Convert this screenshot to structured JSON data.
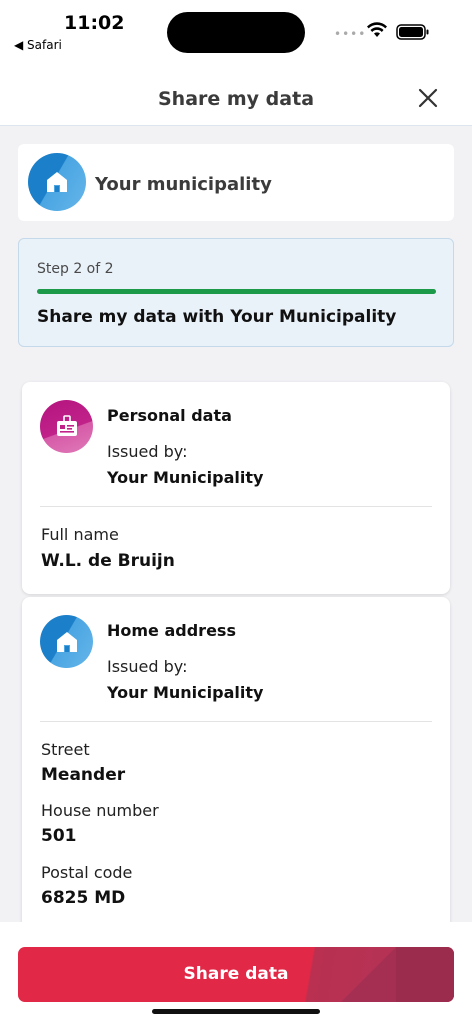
{
  "status_bar": {
    "time": "11:02",
    "back_app": "◀ Safari"
  },
  "header": {
    "title": "Share my data"
  },
  "organization": {
    "name": "Your municipality"
  },
  "step": {
    "label": "Step 2 of 2",
    "progress": 1.0,
    "title": "Share my data with Your Municipality"
  },
  "cards": [
    {
      "title": "Personal data",
      "issued_label": "Issued by:",
      "issuer": "Your Municipality",
      "fields": [
        {
          "label": "Full name",
          "value": "W.L. de Bruijn"
        }
      ]
    },
    {
      "title": "Home address",
      "issued_label": "Issued by:",
      "issuer": "Your Municipality",
      "fields": [
        {
          "label": "Street",
          "value": "Meander"
        },
        {
          "label": "House number",
          "value": "501"
        },
        {
          "label": "Postal code",
          "value": "6825 MD"
        }
      ]
    }
  ],
  "footer": {
    "share_label": "Share data"
  },
  "colors": {
    "accent": "#e22847",
    "progress": "#1c9a4a",
    "step_bg": "#e9f1f9"
  }
}
